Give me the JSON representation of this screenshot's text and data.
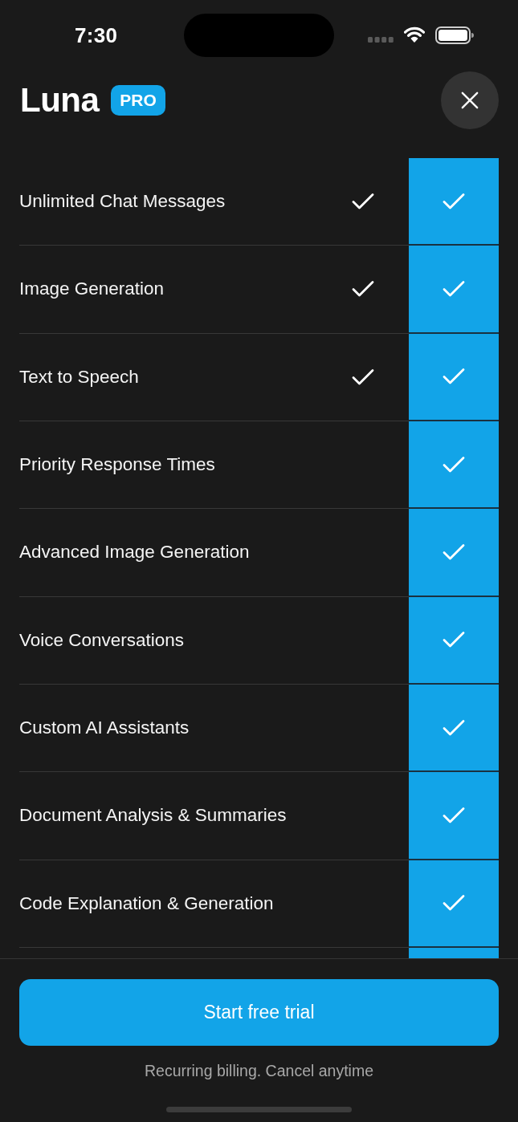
{
  "status_bar": {
    "time": "7:30"
  },
  "header": {
    "app_name": "Luna",
    "badge": "PRO"
  },
  "features": [
    {
      "name": "Unlimited Chat Messages",
      "free": true,
      "pro": true
    },
    {
      "name": "Image Generation",
      "free": true,
      "pro": true
    },
    {
      "name": "Text to Speech",
      "free": true,
      "pro": true
    },
    {
      "name": "Priority Response Times",
      "free": false,
      "pro": true
    },
    {
      "name": "Advanced Image Generation",
      "free": false,
      "pro": true
    },
    {
      "name": "Voice Conversations",
      "free": false,
      "pro": true
    },
    {
      "name": "Custom AI Assistants",
      "free": false,
      "pro": true
    },
    {
      "name": "Document Analysis & Summaries",
      "free": false,
      "pro": true
    },
    {
      "name": "Code Explanation & Generation",
      "free": false,
      "pro": true
    }
  ],
  "cta": {
    "label": "Start free trial"
  },
  "footnote": "Recurring billing. Cancel anytime"
}
